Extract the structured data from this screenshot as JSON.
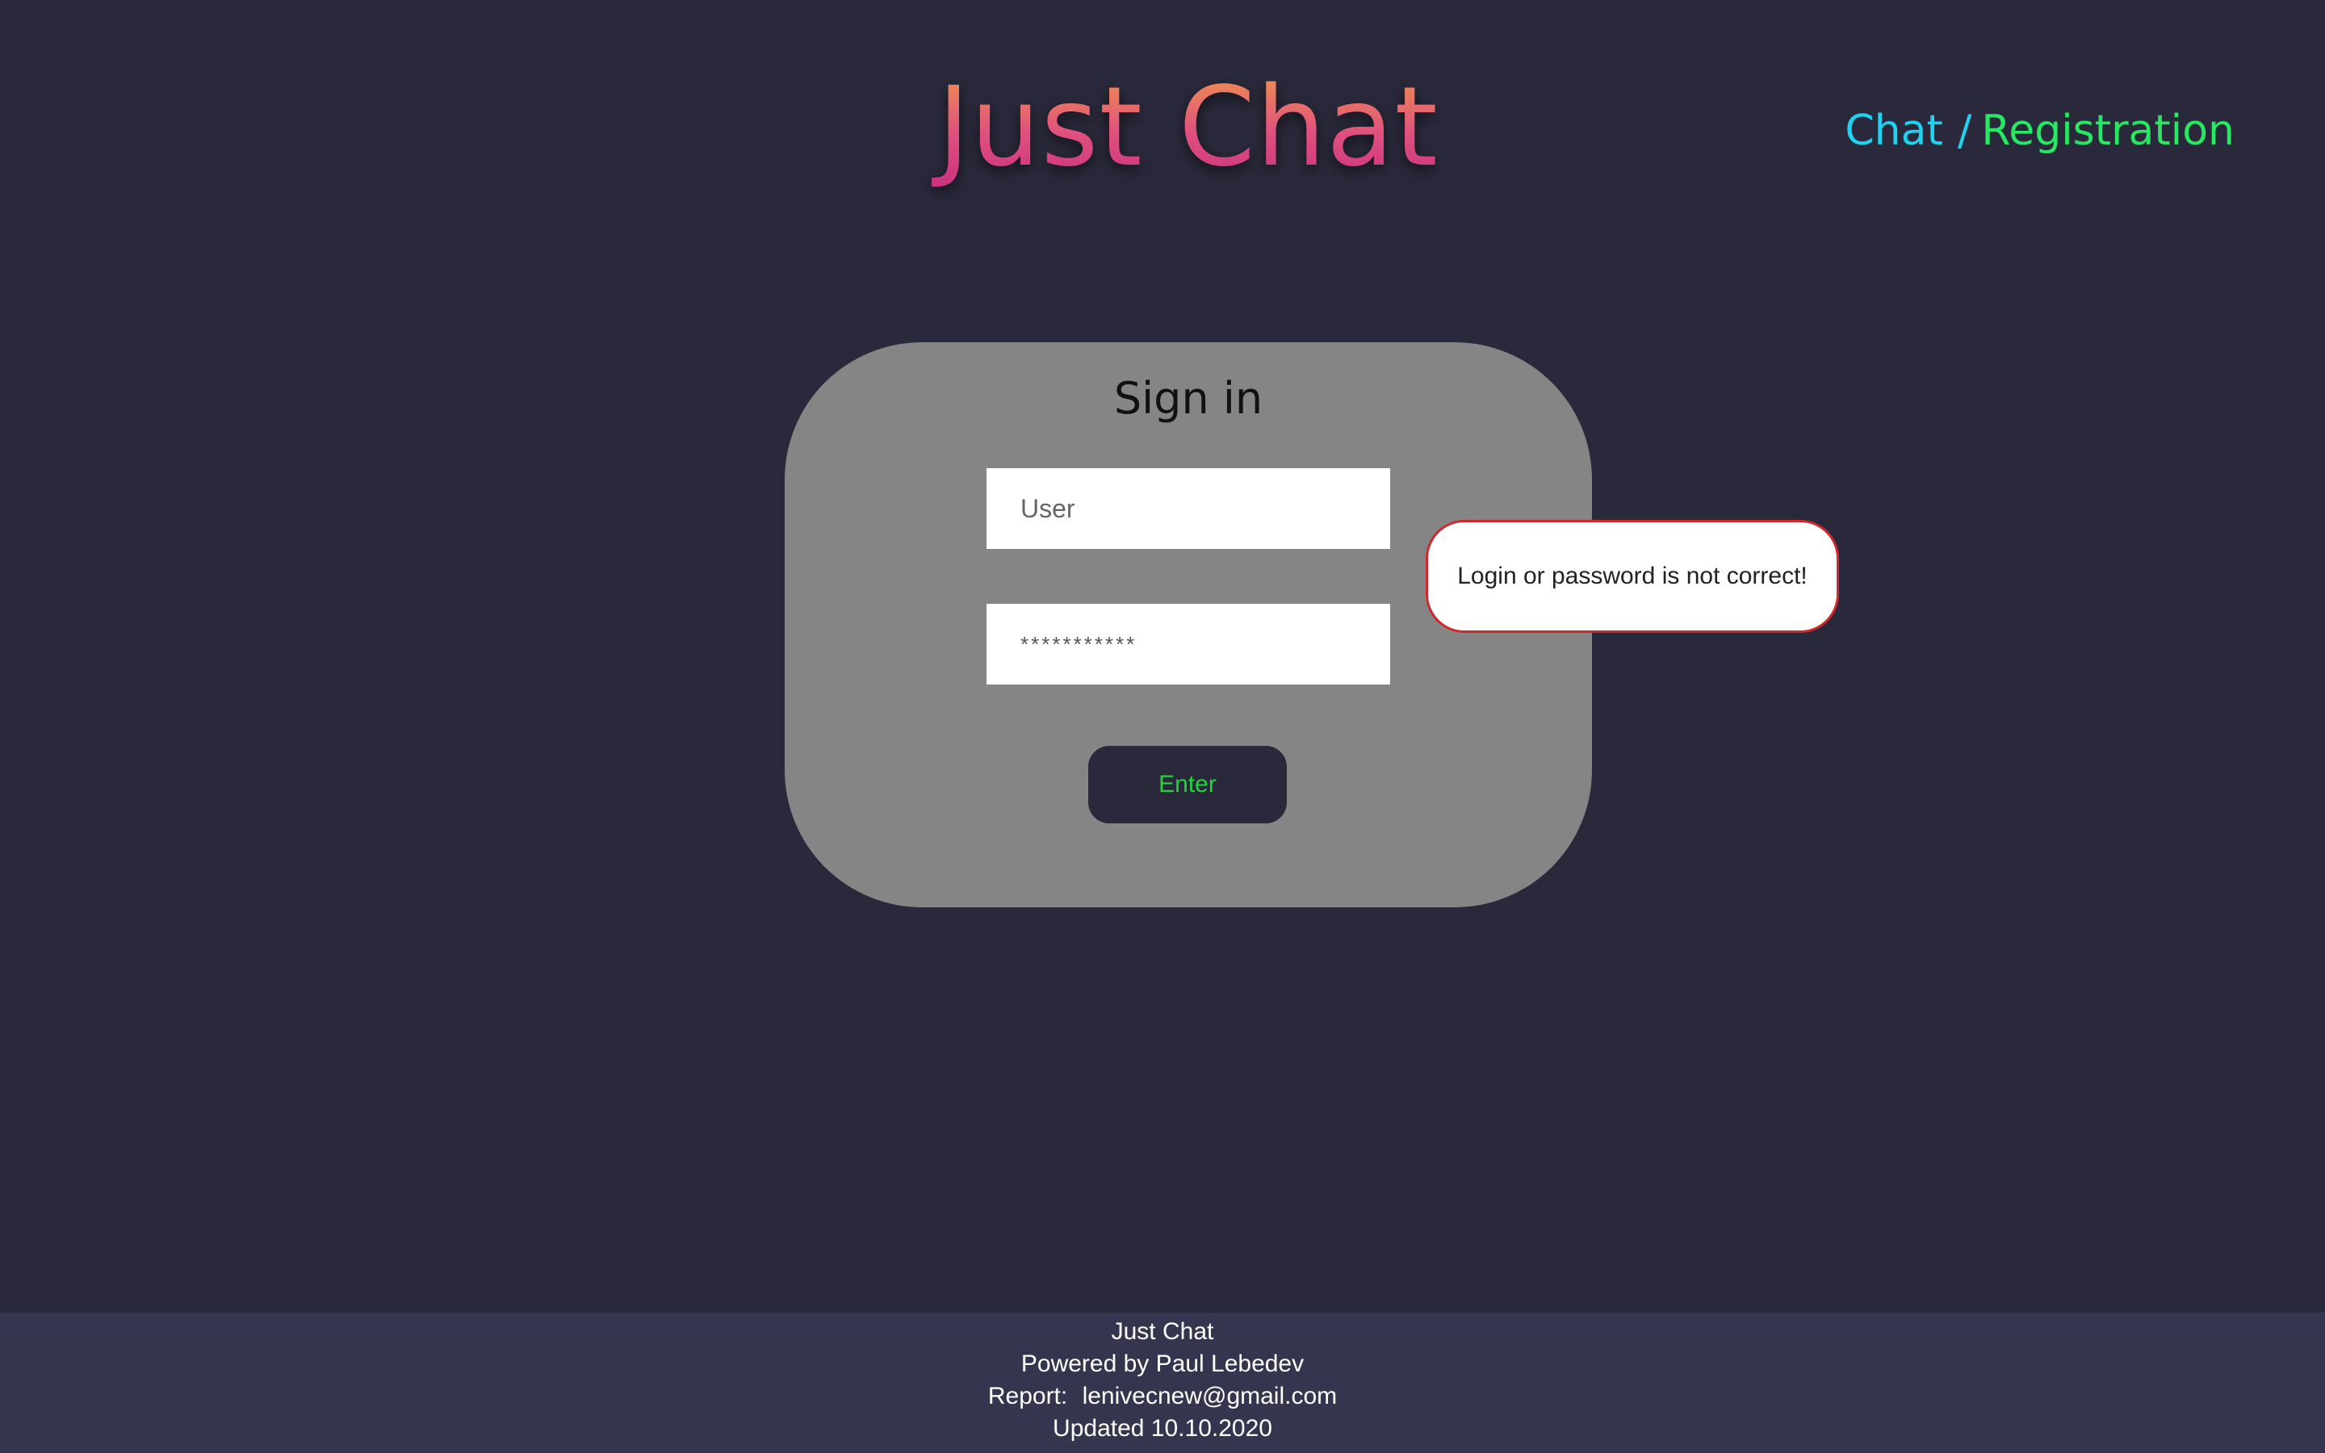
{
  "header": {
    "title": "Just Chat",
    "nav": {
      "chat_label": "Chat",
      "separator": "/",
      "registration_label": "Registration"
    }
  },
  "signin": {
    "heading": "Sign in",
    "user_placeholder": "User",
    "password_value": "***********",
    "enter_label": "Enter"
  },
  "error": {
    "message": "Login or password is not correct!"
  },
  "footer": {
    "app_name": "Just Chat",
    "powered_by": "Powered by Paul Lebedev",
    "report_label": "Report:",
    "report_email": "lenivecnew@gmail.com",
    "updated": "Updated 10.10.2020"
  },
  "colors": {
    "background": "#2a293b",
    "card": "#858585",
    "footer": "#363550",
    "nav_chat": "#1ed2f0",
    "nav_registration": "#27e862",
    "enter_text": "#22d43c",
    "error_border": "#d0282c"
  }
}
